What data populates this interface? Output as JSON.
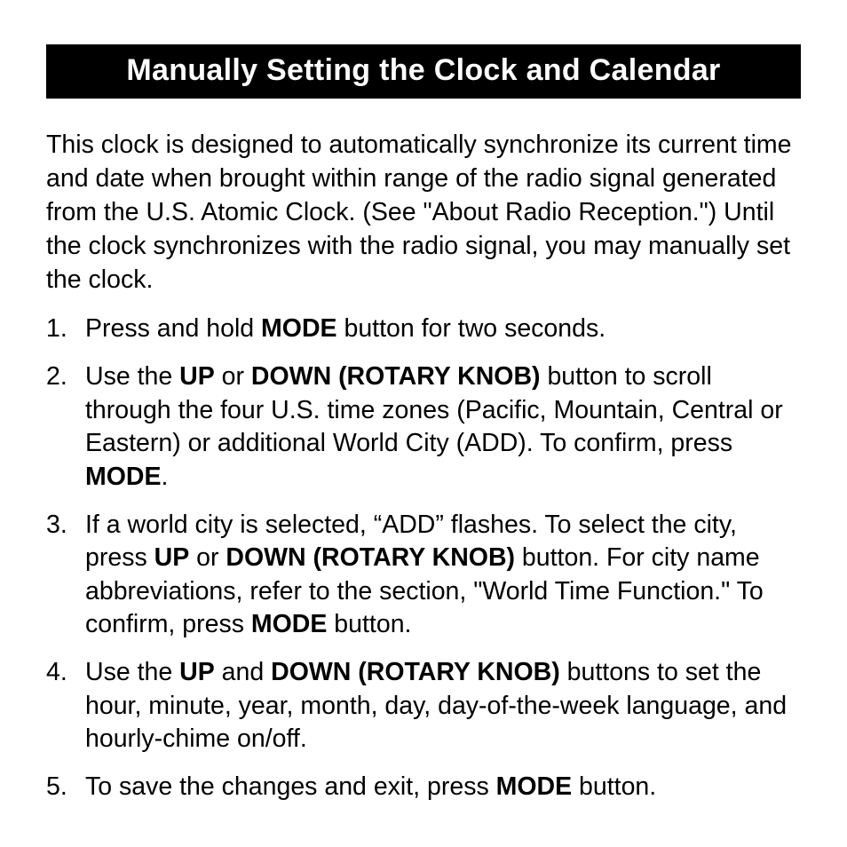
{
  "title": "Manually Setting the Clock and Calendar",
  "intro": "This clock is designed to automatically synchronize its current time and date when brought within range of the radio signal generated from the U.S. Atomic Clock. (See \"About Radio Reception.\") Until the clock synchronizes with the radio signal, you may manually set the clock.",
  "steps": [
    {
      "parts": [
        {
          "t": "Press and hold ",
          "b": false
        },
        {
          "t": "MODE",
          "b": true
        },
        {
          "t": " button for two seconds.",
          "b": false
        }
      ]
    },
    {
      "parts": [
        {
          "t": "Use the ",
          "b": false
        },
        {
          "t": "UP",
          "b": true
        },
        {
          "t": " or ",
          "b": false
        },
        {
          "t": "DOWN (ROTARY KNOB)",
          "b": true
        },
        {
          "t": " button to scroll through the four U.S. time zones (Pacific, Mountain, Central or Eastern) or additional World City (ADD). To confirm, press ",
          "b": false
        },
        {
          "t": "MODE",
          "b": true
        },
        {
          "t": ".",
          "b": false
        }
      ]
    },
    {
      "parts": [
        {
          "t": "If a world city is selected, “ADD” flashes. To select the city, press ",
          "b": false
        },
        {
          "t": "UP",
          "b": true
        },
        {
          "t": " or ",
          "b": false
        },
        {
          "t": "DOWN (ROTARY KNOB)",
          "b": true
        },
        {
          "t": " button. For city name abbreviations, refer to the section, \"World Time Function.\" To confirm, press ",
          "b": false
        },
        {
          "t": "MODE",
          "b": true
        },
        {
          "t": " button.",
          "b": false
        }
      ]
    },
    {
      "parts": [
        {
          "t": "Use the ",
          "b": false
        },
        {
          "t": "UP",
          "b": true
        },
        {
          "t": " and ",
          "b": false
        },
        {
          "t": "DOWN (ROTARY KNOB)",
          "b": true
        },
        {
          "t": " buttons to set the hour, minute, year, month, day, day-of-the-week language, and hourly-chime on/off.",
          "b": false
        }
      ]
    },
    {
      "parts": [
        {
          "t": "To save the changes and exit, press ",
          "b": false
        },
        {
          "t": "MODE",
          "b": true
        },
        {
          "t": " button.",
          "b": false
        }
      ]
    }
  ]
}
